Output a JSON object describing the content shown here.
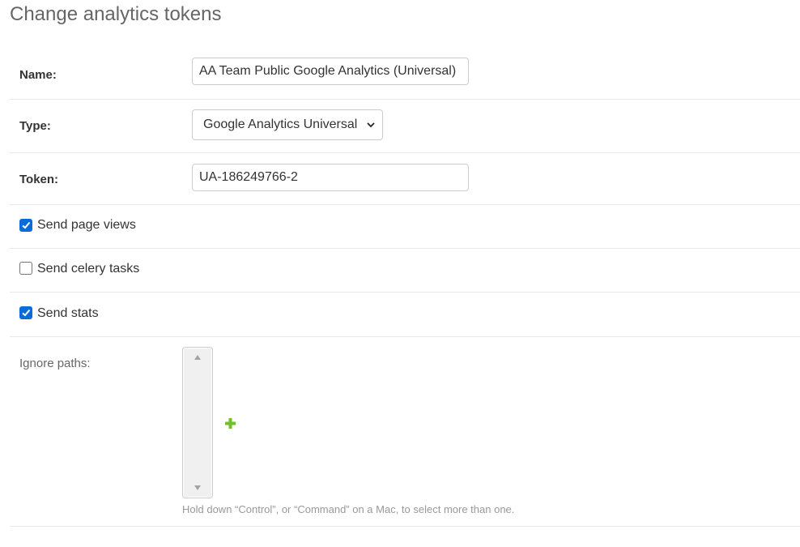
{
  "page": {
    "title": "Change analytics tokens"
  },
  "form": {
    "name": {
      "label": "Name:",
      "value": "AA Team Public Google Analytics (Universal)"
    },
    "type": {
      "label": "Type:",
      "selected": "Google Analytics Universal"
    },
    "token": {
      "label": "Token:",
      "value": "UA-186249766-2"
    },
    "send_page_views": {
      "label": "Send page views",
      "checked": true
    },
    "send_celery_tasks": {
      "label": "Send celery tasks",
      "checked": false
    },
    "send_stats": {
      "label": "Send stats",
      "checked": true
    },
    "ignore_paths": {
      "label": "Ignore paths:",
      "help_text": "Hold down “Control”, or “Command” on a Mac, to select more than one.",
      "add_icon": "plus-icon"
    }
  },
  "colors": {
    "checkbox_checked": "#0b6cd9",
    "add_icon": "#70bf2b",
    "help_text": "#999999"
  }
}
